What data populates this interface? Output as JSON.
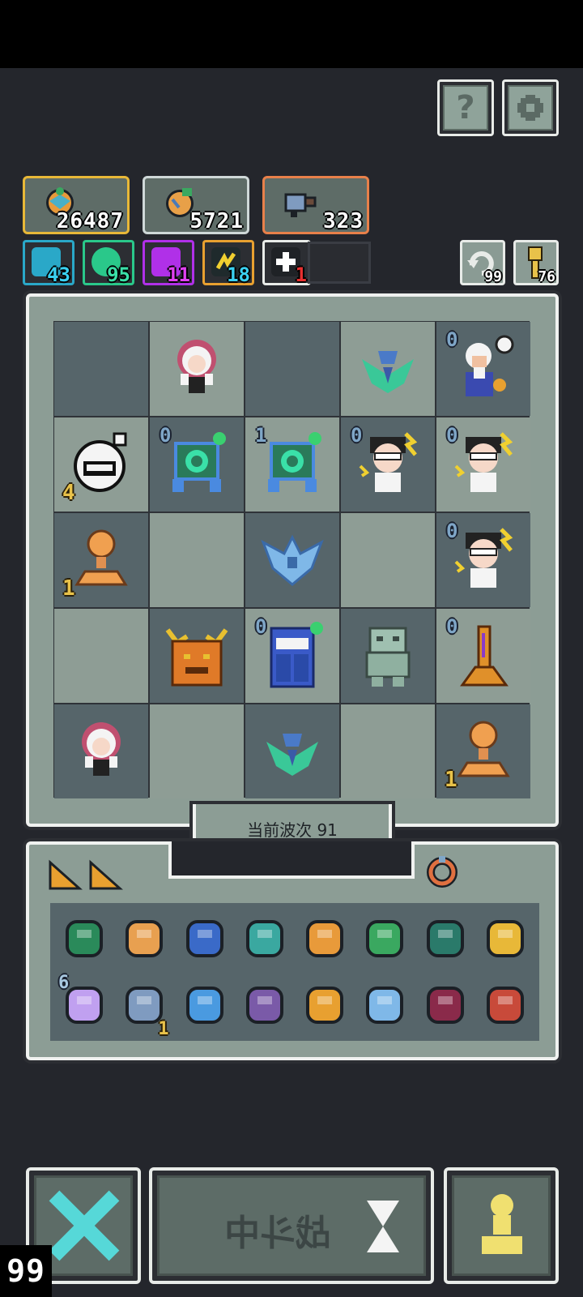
{
  "header": {
    "help_icon": "question-mark-icon",
    "settings_icon": "gear-icon"
  },
  "resources": [
    {
      "name": "gold",
      "value": "26487",
      "color": "#e8b838"
    },
    {
      "name": "gems",
      "value": "5721",
      "color": "#cfd8d8"
    },
    {
      "name": "weapons",
      "value": "323",
      "color": "#e8804a"
    }
  ],
  "elements": [
    {
      "name": "water",
      "count": "43",
      "color": "#2aa8c8",
      "count_color": "#3ad0f0"
    },
    {
      "name": "wind",
      "count": "95",
      "color": "#2ac88a",
      "count_color": "#3ae0a8"
    },
    {
      "name": "arcane",
      "count": "11",
      "color": "#b030e8",
      "count_color": "#e040f0"
    },
    {
      "name": "lightning",
      "count": "18",
      "color": "#e8a030",
      "count_color": "#3ad0f0"
    },
    {
      "name": "star",
      "count": "1",
      "color": "#e8ebe8",
      "count_color": "#e83030"
    }
  ],
  "minis": [
    {
      "name": "refresh",
      "count": "99"
    },
    {
      "name": "key",
      "count": "76"
    }
  ],
  "board": {
    "cells": [
      {
        "shade": "dark",
        "unit": "",
        "level": "",
        "count": ""
      },
      {
        "shade": "light",
        "unit": "fairy-girl",
        "level": "",
        "count": ""
      },
      {
        "shade": "dark",
        "unit": "",
        "level": "",
        "count": ""
      },
      {
        "shade": "light",
        "unit": "crystal-bird",
        "level": "",
        "count": ""
      },
      {
        "shade": "dark",
        "unit": "old-bard",
        "level": "0",
        "count": ""
      },
      {
        "shade": "light",
        "unit": "bottle-monster",
        "level": "",
        "count": "4"
      },
      {
        "shade": "dark",
        "unit": "green-robot",
        "level": "0",
        "count": ""
      },
      {
        "shade": "light",
        "unit": "green-robot",
        "level": "1",
        "count": ""
      },
      {
        "shade": "dark",
        "unit": "thunder-scientist",
        "level": "0",
        "count": ""
      },
      {
        "shade": "light",
        "unit": "thunder-scientist",
        "level": "0",
        "count": ""
      },
      {
        "shade": "dark",
        "unit": "orb-pedestal",
        "level": "",
        "count": "1"
      },
      {
        "shade": "light",
        "unit": "",
        "level": "",
        "count": ""
      },
      {
        "shade": "dark",
        "unit": "ice-bat",
        "level": "",
        "count": ""
      },
      {
        "shade": "light",
        "unit": "",
        "level": "",
        "count": ""
      },
      {
        "shade": "dark",
        "unit": "thunder-scientist",
        "level": "0",
        "count": ""
      },
      {
        "shade": "light",
        "unit": "",
        "level": "",
        "count": ""
      },
      {
        "shade": "dark",
        "unit": "horned-beast",
        "level": "",
        "count": ""
      },
      {
        "shade": "light",
        "unit": "blue-cabinet",
        "level": "0",
        "count": ""
      },
      {
        "shade": "dark",
        "unit": "stone-golem",
        "level": "",
        "count": ""
      },
      {
        "shade": "light",
        "unit": "magic-tree",
        "level": "0",
        "count": ""
      },
      {
        "shade": "dark",
        "unit": "fairy-girl",
        "level": "",
        "count": ""
      },
      {
        "shade": "light",
        "unit": "",
        "level": "",
        "count": ""
      },
      {
        "shade": "dark",
        "unit": "crystal-bird",
        "level": "",
        "count": ""
      },
      {
        "shade": "light",
        "unit": "",
        "level": "",
        "count": ""
      },
      {
        "shade": "dark",
        "unit": "orb-pedestal",
        "level": "",
        "count": "1"
      }
    ]
  },
  "wave": {
    "label": "当前波次 91"
  },
  "inventory": {
    "items": [
      {
        "name": "green-shell",
        "top": "",
        "bottom": ""
      },
      {
        "name": "striped-scroll",
        "top": "",
        "bottom": ""
      },
      {
        "name": "blue-goggles",
        "top": "",
        "bottom": ""
      },
      {
        "name": "butterfly-coin",
        "top": "",
        "bottom": ""
      },
      {
        "name": "orange-orb",
        "top": "",
        "bottom": ""
      },
      {
        "name": "green-potion",
        "top": "",
        "bottom": ""
      },
      {
        "name": "green-gauntlet",
        "top": "",
        "bottom": ""
      },
      {
        "name": "gold-shield",
        "top": "",
        "bottom": ""
      },
      {
        "name": "sparkle-star",
        "top": "6",
        "bottom": ""
      },
      {
        "name": "hammer",
        "top": "",
        "bottom": "1"
      },
      {
        "name": "blue-gear",
        "top": "",
        "bottom": ""
      },
      {
        "name": "purple-sock",
        "top": "",
        "bottom": ""
      },
      {
        "name": "fox-spark",
        "top": "",
        "bottom": ""
      },
      {
        "name": "ice-blade",
        "top": "",
        "bottom": ""
      },
      {
        "name": "dna-helix",
        "top": "",
        "bottom": ""
      },
      {
        "name": "red-leaf",
        "top": "",
        "bottom": ""
      }
    ]
  },
  "controls": {
    "fight_label": "战斗中",
    "speed_count": "99"
  }
}
